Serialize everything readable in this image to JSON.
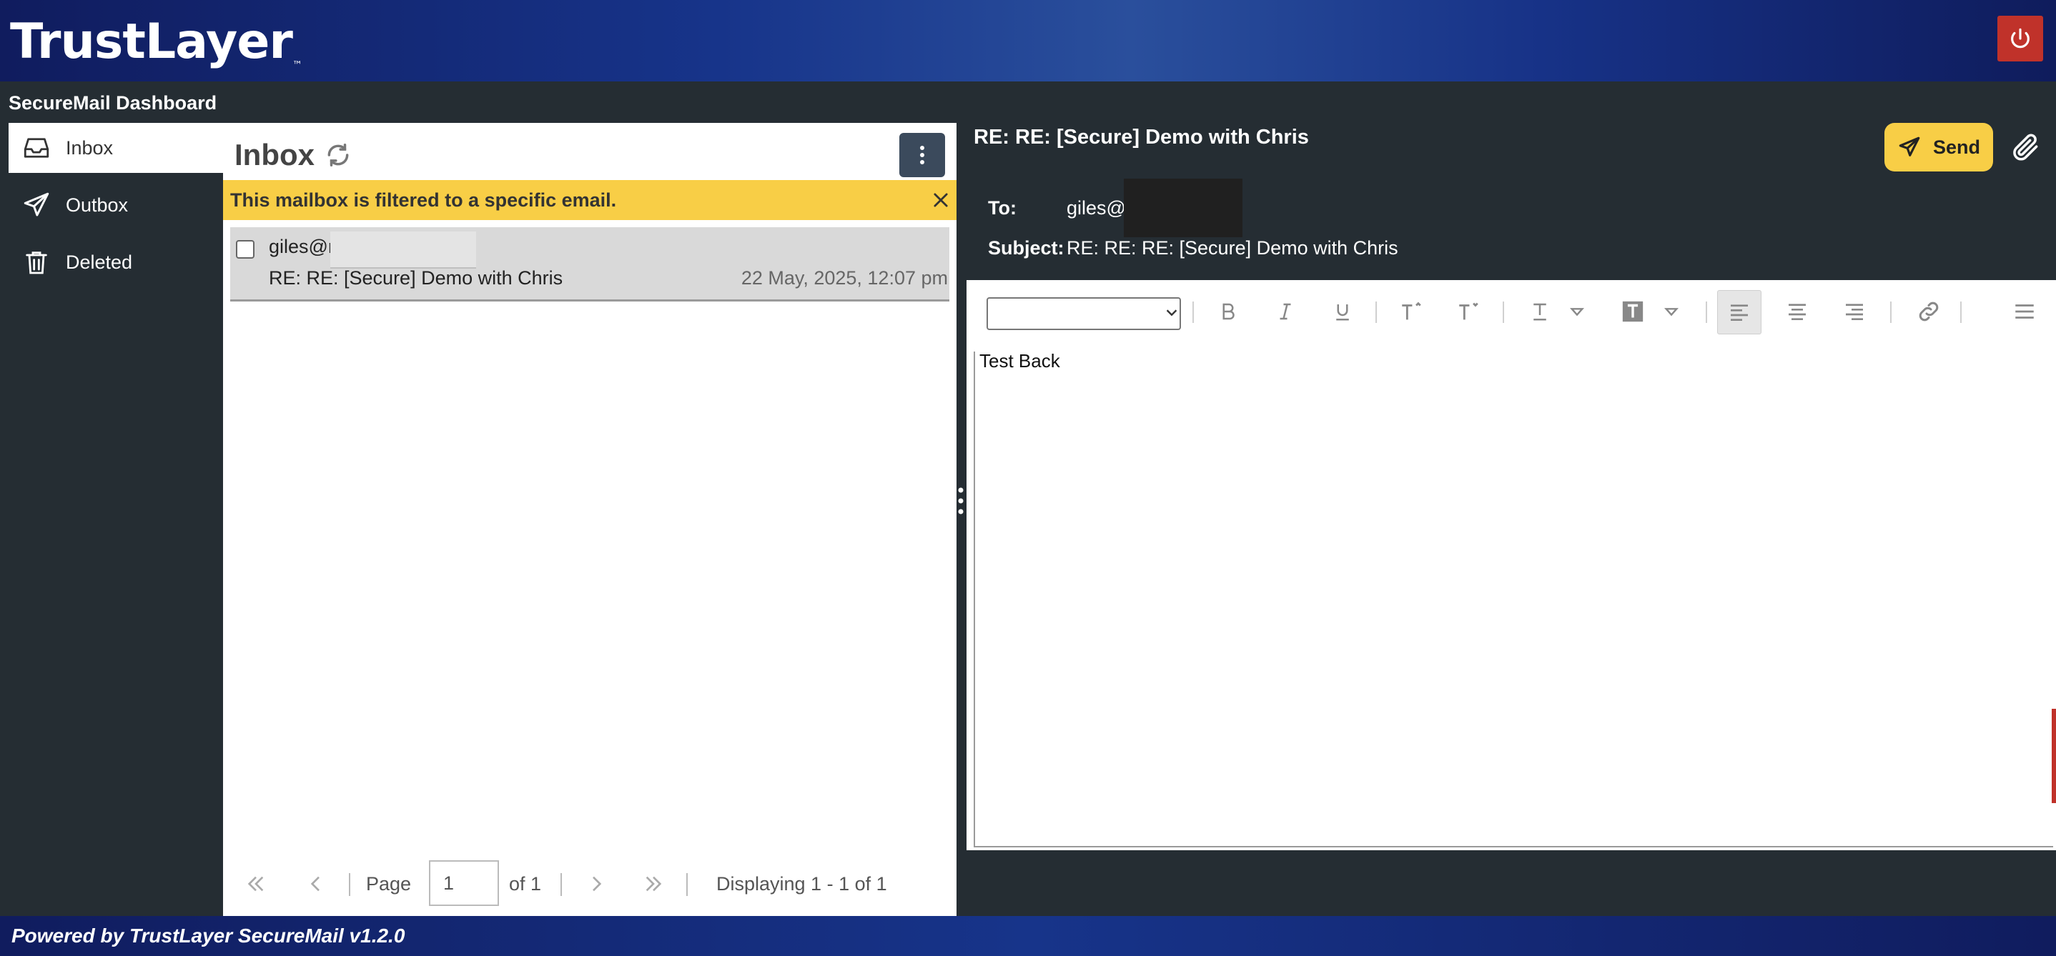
{
  "app": {
    "logo": "TrustLayer",
    "logo_mark": "™",
    "dashboard_title": "SecureMail Dashboard"
  },
  "nav": {
    "items": [
      {
        "label": "Inbox",
        "icon": "inbox-icon",
        "active": true
      },
      {
        "label": "Outbox",
        "icon": "send-icon",
        "active": false
      },
      {
        "label": "Deleted",
        "icon": "trash-icon",
        "active": false
      }
    ]
  },
  "inbox": {
    "title": "Inbox",
    "filter_banner": "This mailbox is filtered to a specific email.",
    "messages": [
      {
        "from": "giles@r",
        "subject": "RE: RE: [Secure] Demo with Chris",
        "date": "22 May, 2025, 12:07 pm",
        "selected": false
      }
    ],
    "pager": {
      "page_label": "Page",
      "page_value": "1",
      "of_label": "of 1",
      "display": "Displaying 1 - 1 of 1"
    }
  },
  "compose": {
    "title": "RE: RE: [Secure] Demo with Chris",
    "send_label": "Send",
    "to_label": "To:",
    "to_value": "giles@",
    "subject_label": "Subject:",
    "subject_value": "RE: RE: RE: [Secure] Demo with Chris",
    "body": "Test Back",
    "font_select_value": ""
  },
  "footer": {
    "text": "Powered by TrustLayer SecureMail v1.2.0"
  },
  "colors": {
    "header_blue": "#17348a",
    "dark_bg": "#252d33",
    "banner_yellow": "#f8ce46",
    "power_red": "#c0322a"
  }
}
